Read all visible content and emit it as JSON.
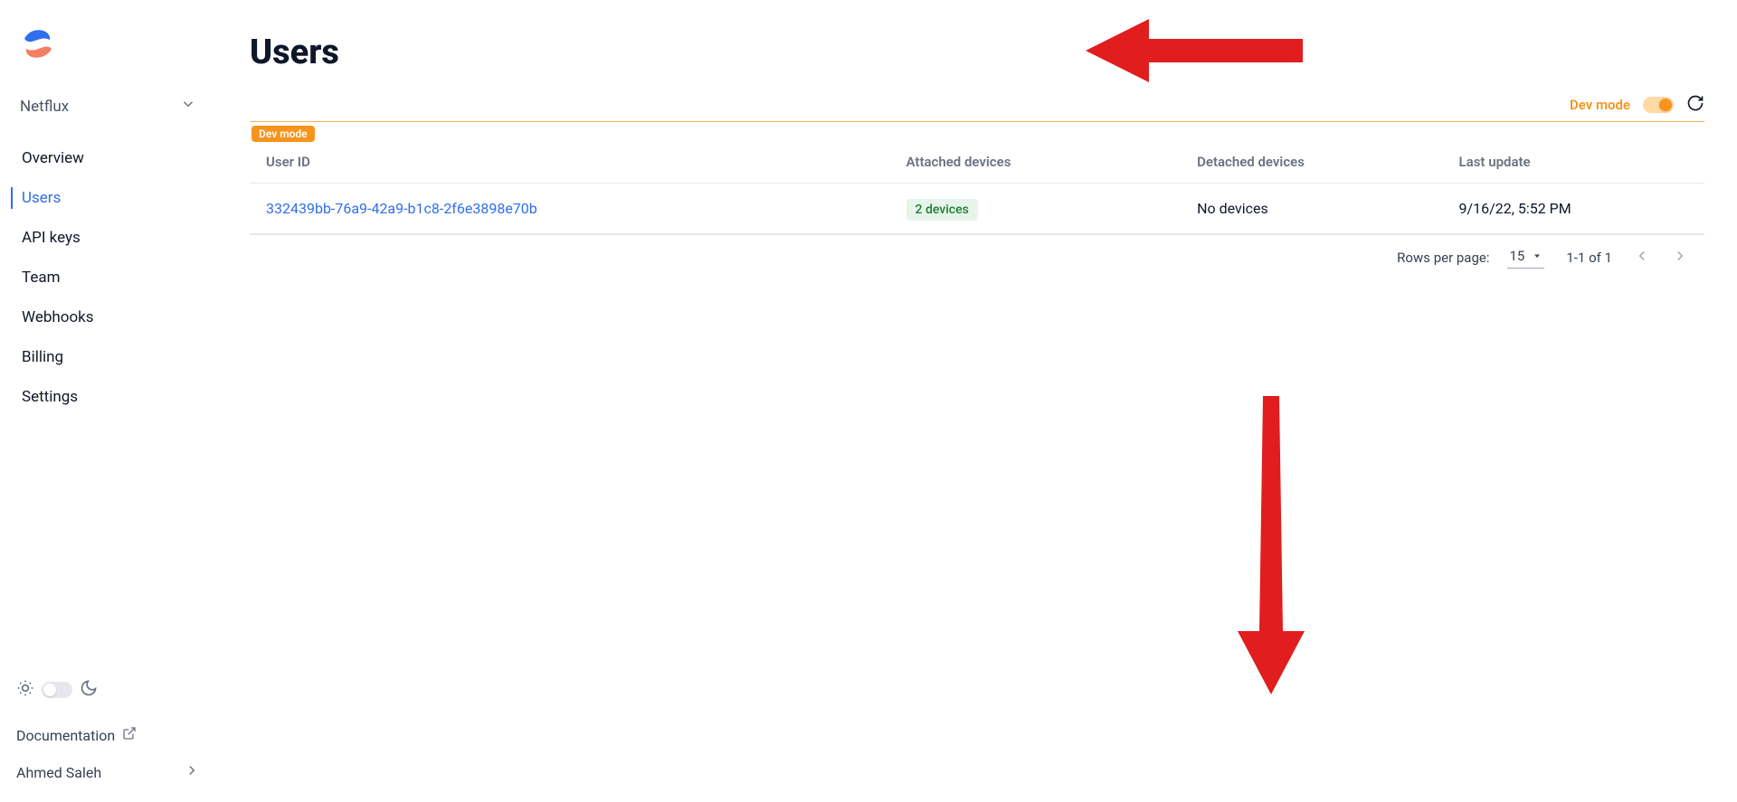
{
  "org": {
    "name": "Netflux"
  },
  "nav": [
    {
      "label": "Overview"
    },
    {
      "label": "Users",
      "active": true
    },
    {
      "label": "API keys"
    },
    {
      "label": "Team"
    },
    {
      "label": "Webhooks"
    },
    {
      "label": "Billing"
    },
    {
      "label": "Settings"
    }
  ],
  "page": {
    "title": "Users"
  },
  "dev_mode": {
    "label": "Dev mode",
    "enabled": true,
    "badge": "Dev mode"
  },
  "table": {
    "headers": {
      "user_id": "User ID",
      "attached": "Attached devices",
      "detached": "Detached devices",
      "updated": "Last update"
    },
    "rows": [
      {
        "user_id": "332439bb-76a9-42a9-b1c8-2f6e3898e70b",
        "attached": "2 devices",
        "detached": "No devices",
        "updated": "9/16/22, 5:52 PM"
      }
    ]
  },
  "pager": {
    "rows_per_page_label": "Rows per page:",
    "rows_per_page": "15",
    "range": "1-1 of 1"
  },
  "footer": {
    "documentation": "Documentation",
    "account_name": "Ahmed Saleh"
  }
}
